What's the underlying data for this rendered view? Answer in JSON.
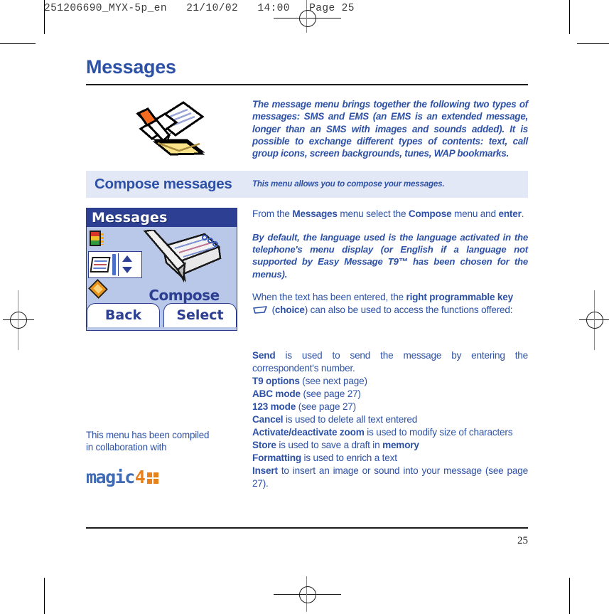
{
  "prepress": {
    "header_line": "251206690_MYX-5p_en   21/10/02   14:00   Page 25"
  },
  "page": {
    "title": "Messages",
    "intro_icon": "message-compose-illustration",
    "intro_text": "The message menu brings together the following two types of messages: SMS and EMS (an EMS is an extended message, longer than an SMS with images and sounds added). It is possible to exchange different types of contents: text, call group icons, screen backgrounds, tunes, WAP bookmarks.",
    "banner": {
      "title": "Compose messages",
      "subtitle": "This menu allows you to compose your messages."
    },
    "phone_screen": {
      "title": "Messages",
      "selected_item_label": "Compose",
      "left_softkey": "Back",
      "right_softkey": "Select",
      "icons": [
        "battery-level-icon",
        "notepad-list-icon",
        "gold-envelope-icon",
        "up-down-arrows-icon"
      ]
    },
    "right_column": {
      "para1": {
        "p1": "From the ",
        "b1": "Messages",
        "p2": " menu select the ",
        "b2": "Compose",
        "p3": " menu and ",
        "b3": "enter",
        "p4": "."
      },
      "para2": "By default, the language used is  the language activated in the telephone's menu display (or English if a language not supported by Easy Message T9™ has been chosen for the menus).",
      "para3": {
        "p1": "When the text has been entered, the ",
        "b1": "right programmable key",
        "glyph": "soft-key-glyph",
        "p2": " (",
        "b2": "choice",
        "p3": ") can also be used to access the functions offered:"
      },
      "functions": [
        {
          "term": "Send",
          "rest": " is used to send the message by entering the correspondent's number."
        },
        {
          "term": "T9 options",
          "rest": " (see next page)"
        },
        {
          "term": "ABC mode",
          "rest": " (see page 27)"
        },
        {
          "term": "123 mode",
          "rest": " (see page 27)"
        },
        {
          "term": "Cancel",
          "rest": " is used to delete all text entered"
        },
        {
          "term": "Activate/deactivate zoom",
          "rest": " is used to modify size of characters"
        },
        {
          "term": "Store",
          "rest": " is used to save a draft in ",
          "term2": "memory"
        },
        {
          "term": "Formatting",
          "rest": " is used to enrich a text"
        },
        {
          "term": "Insert",
          "rest": " to insert an image or sound into your message (see page 27)."
        }
      ]
    },
    "left_note": {
      "text": "This menu has been compiled in collaboration with",
      "logo": {
        "word": "magic",
        "four": "4",
        "dots": "four-dots-icon"
      }
    },
    "page_number": "25"
  },
  "colors": {
    "brand_blue": "#2d51a6",
    "banner_bg": "#e3e8f7",
    "phone_bg": "#b9c8e8",
    "phone_titlebar": "#2c3f92",
    "logo_orange": "#e8801c"
  }
}
